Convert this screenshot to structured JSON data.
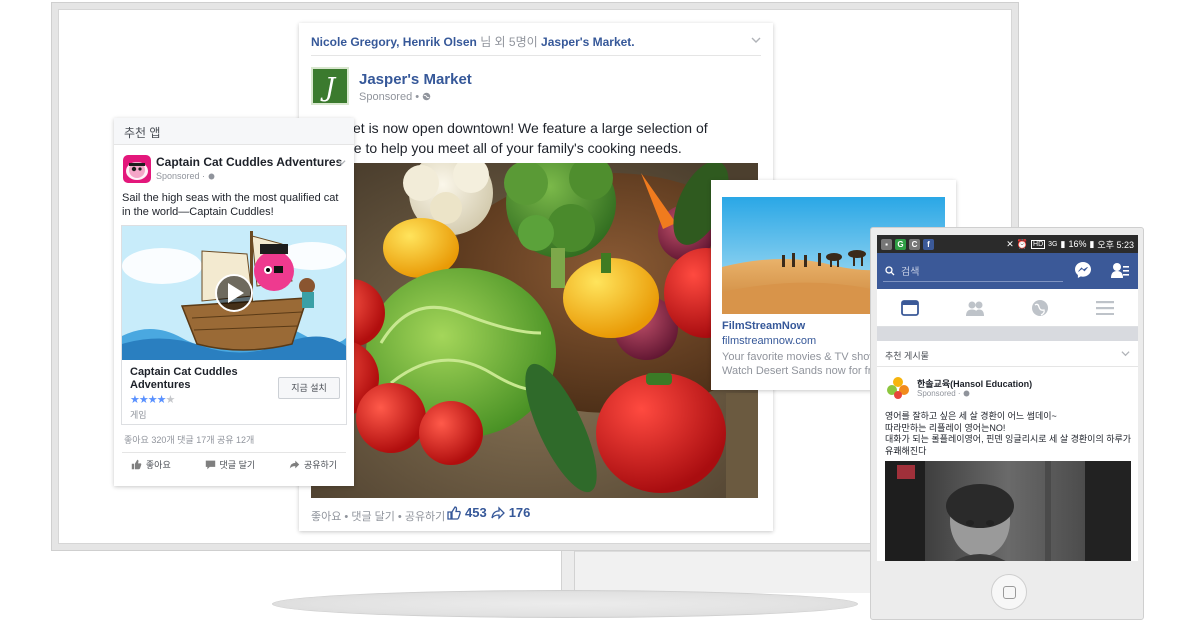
{
  "main_post": {
    "context_names": "Nicole Gregory, Henrik Olsen",
    "context_suffix": "님 외 5명이",
    "context_page": "Jasper's Market.",
    "page_name": "Jasper's Market",
    "logo_letter": "J",
    "sponsored": "Sponsored • ",
    "text": "s Market is now open downtown! We feature a large selection of produce to help you meet all of your family's cooking needs.",
    "actions": "좋아요 • 댓글 달기 • 공유하기",
    "like_count": "453",
    "share_count": "176"
  },
  "app_ad": {
    "header": "추천 앱",
    "advertiser": "Captain Cat Cuddles Adventures",
    "sponsored": "Sponsored · ",
    "text": "Sail the high seas with the most qualified cat in the world—Captain Cuddles!",
    "app_name": "Captain Cat Cuddles Adventures",
    "stars_on": "★★★★",
    "stars_off": "★",
    "category": "게임",
    "install_label": "지금 설치",
    "counts": "좋아요 320개   댓글 17개   공유 12개",
    "like_label": "좋아요",
    "comment_label": "댓글 달기",
    "share_label": "공유하기"
  },
  "link_ad": {
    "title": "FilmStreamNow",
    "url": "filmstreamnow.com",
    "desc_line1": "Your favorite movies & TV shows",
    "desc_line2": "Watch Desert Sands now for free"
  },
  "phone": {
    "status_net": "3G",
    "status_battery": "16%",
    "status_time": "오후 5:23",
    "status_chip_g": "G",
    "status_chip_c": "C",
    "status_chip_f": "f",
    "search_placeholder": "검색",
    "section_title": "추천 게시물",
    "post_name": "한솔교육(Hansol Education)",
    "post_sponsored": "Sponsored · ",
    "post_text_1": "영어를 잘하고 싶은 세 살 경환이 어느 썸데이~",
    "post_text_2": "따라만하는 리플레이 영어는NO!",
    "post_text_3": "대화가 되는 롤플레이영어, 핀덴 잉글리시로 세 살 경환이의 하루가",
    "post_text_4": "유쾌해진다"
  },
  "colors": {
    "facebook_blue": "#3b5998",
    "link_blue": "#365899",
    "meta_gray": "#90949c"
  }
}
